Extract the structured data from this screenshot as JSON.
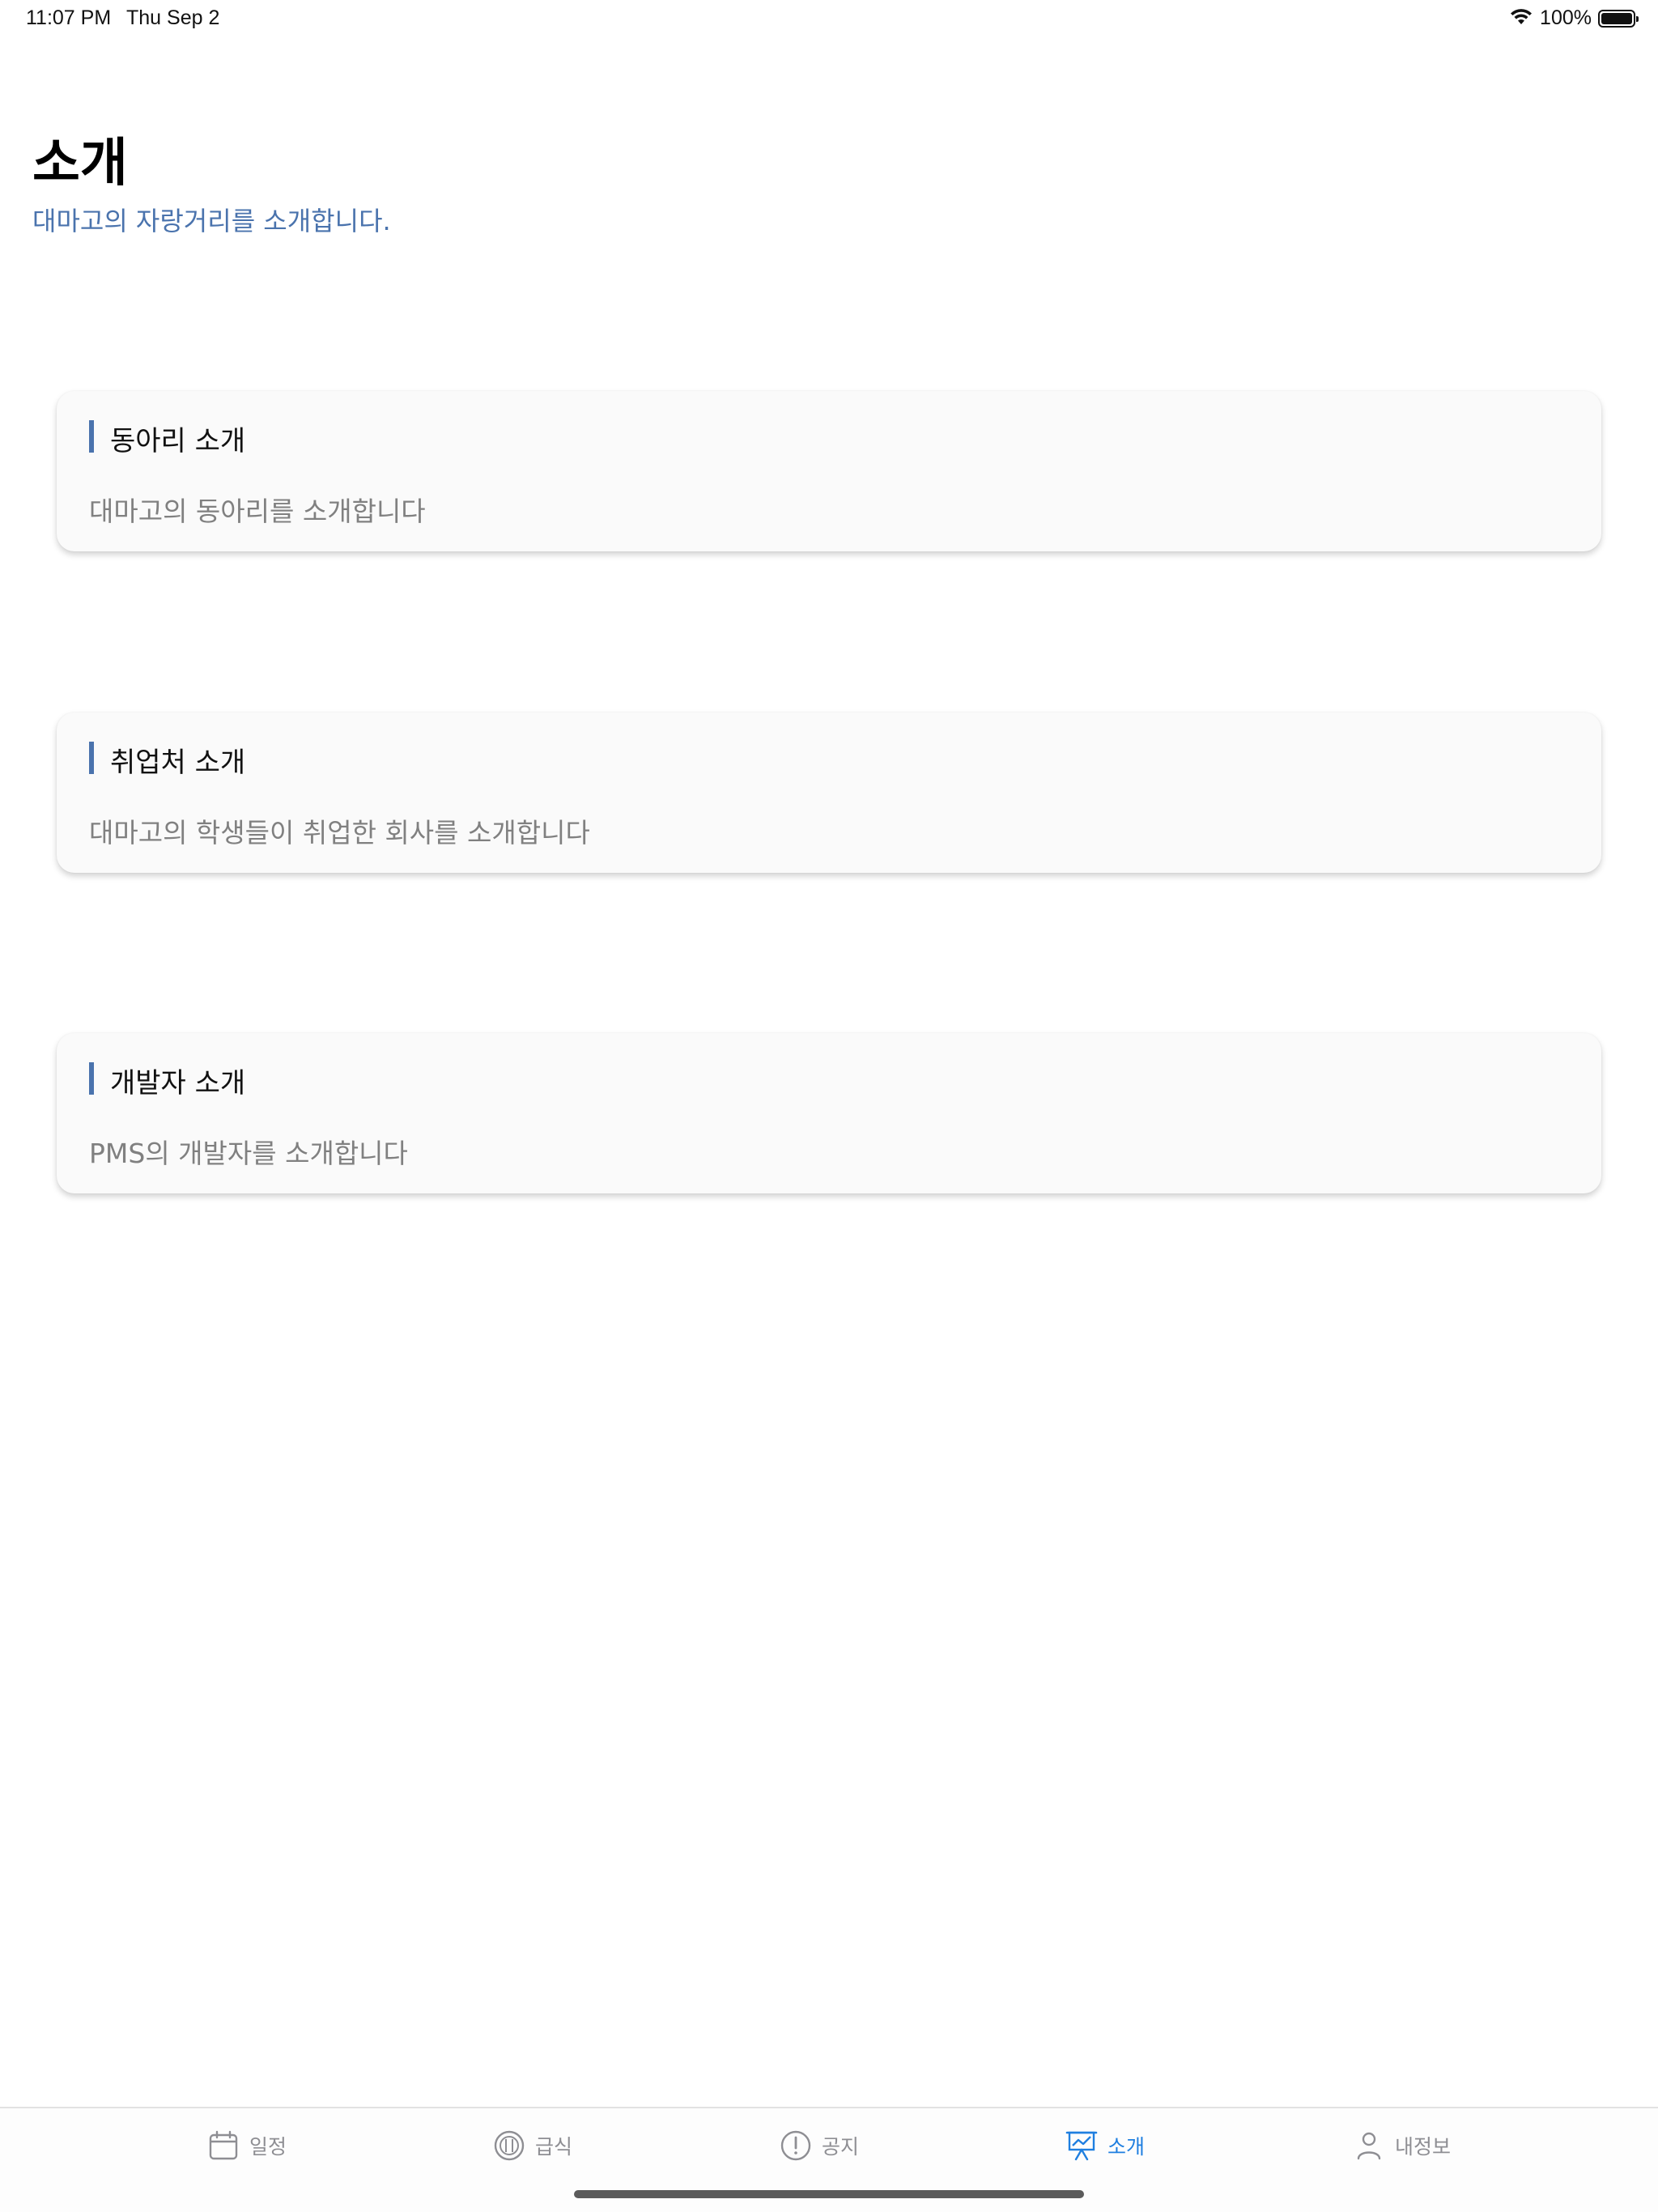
{
  "status_bar": {
    "time": "11:07 PM",
    "date": "Thu Sep 2",
    "battery": "100%"
  },
  "header": {
    "title": "소개",
    "subtitle": "대마고의 자랑거리를 소개합니다."
  },
  "cards": [
    {
      "title": "동아리 소개",
      "description": "대마고의 동아리를 소개합니다"
    },
    {
      "title": "취업처 소개",
      "description": "대마고의 학생들이 취업한 회사를 소개합니다"
    },
    {
      "title": "개발자 소개",
      "description": "PMS의 개발자를 소개합니다"
    }
  ],
  "tabs": [
    {
      "label": "일정",
      "icon": "calendar-icon",
      "active": false
    },
    {
      "label": "급식",
      "icon": "meal-icon",
      "active": false
    },
    {
      "label": "공지",
      "icon": "alert-icon",
      "active": false
    },
    {
      "label": "소개",
      "icon": "presentation-icon",
      "active": true
    },
    {
      "label": "내정보",
      "icon": "person-icon",
      "active": false
    }
  ],
  "colors": {
    "accent": "#4a73ad",
    "tab_active": "#1f7fe0",
    "tab_inactive": "#8e8e93"
  }
}
